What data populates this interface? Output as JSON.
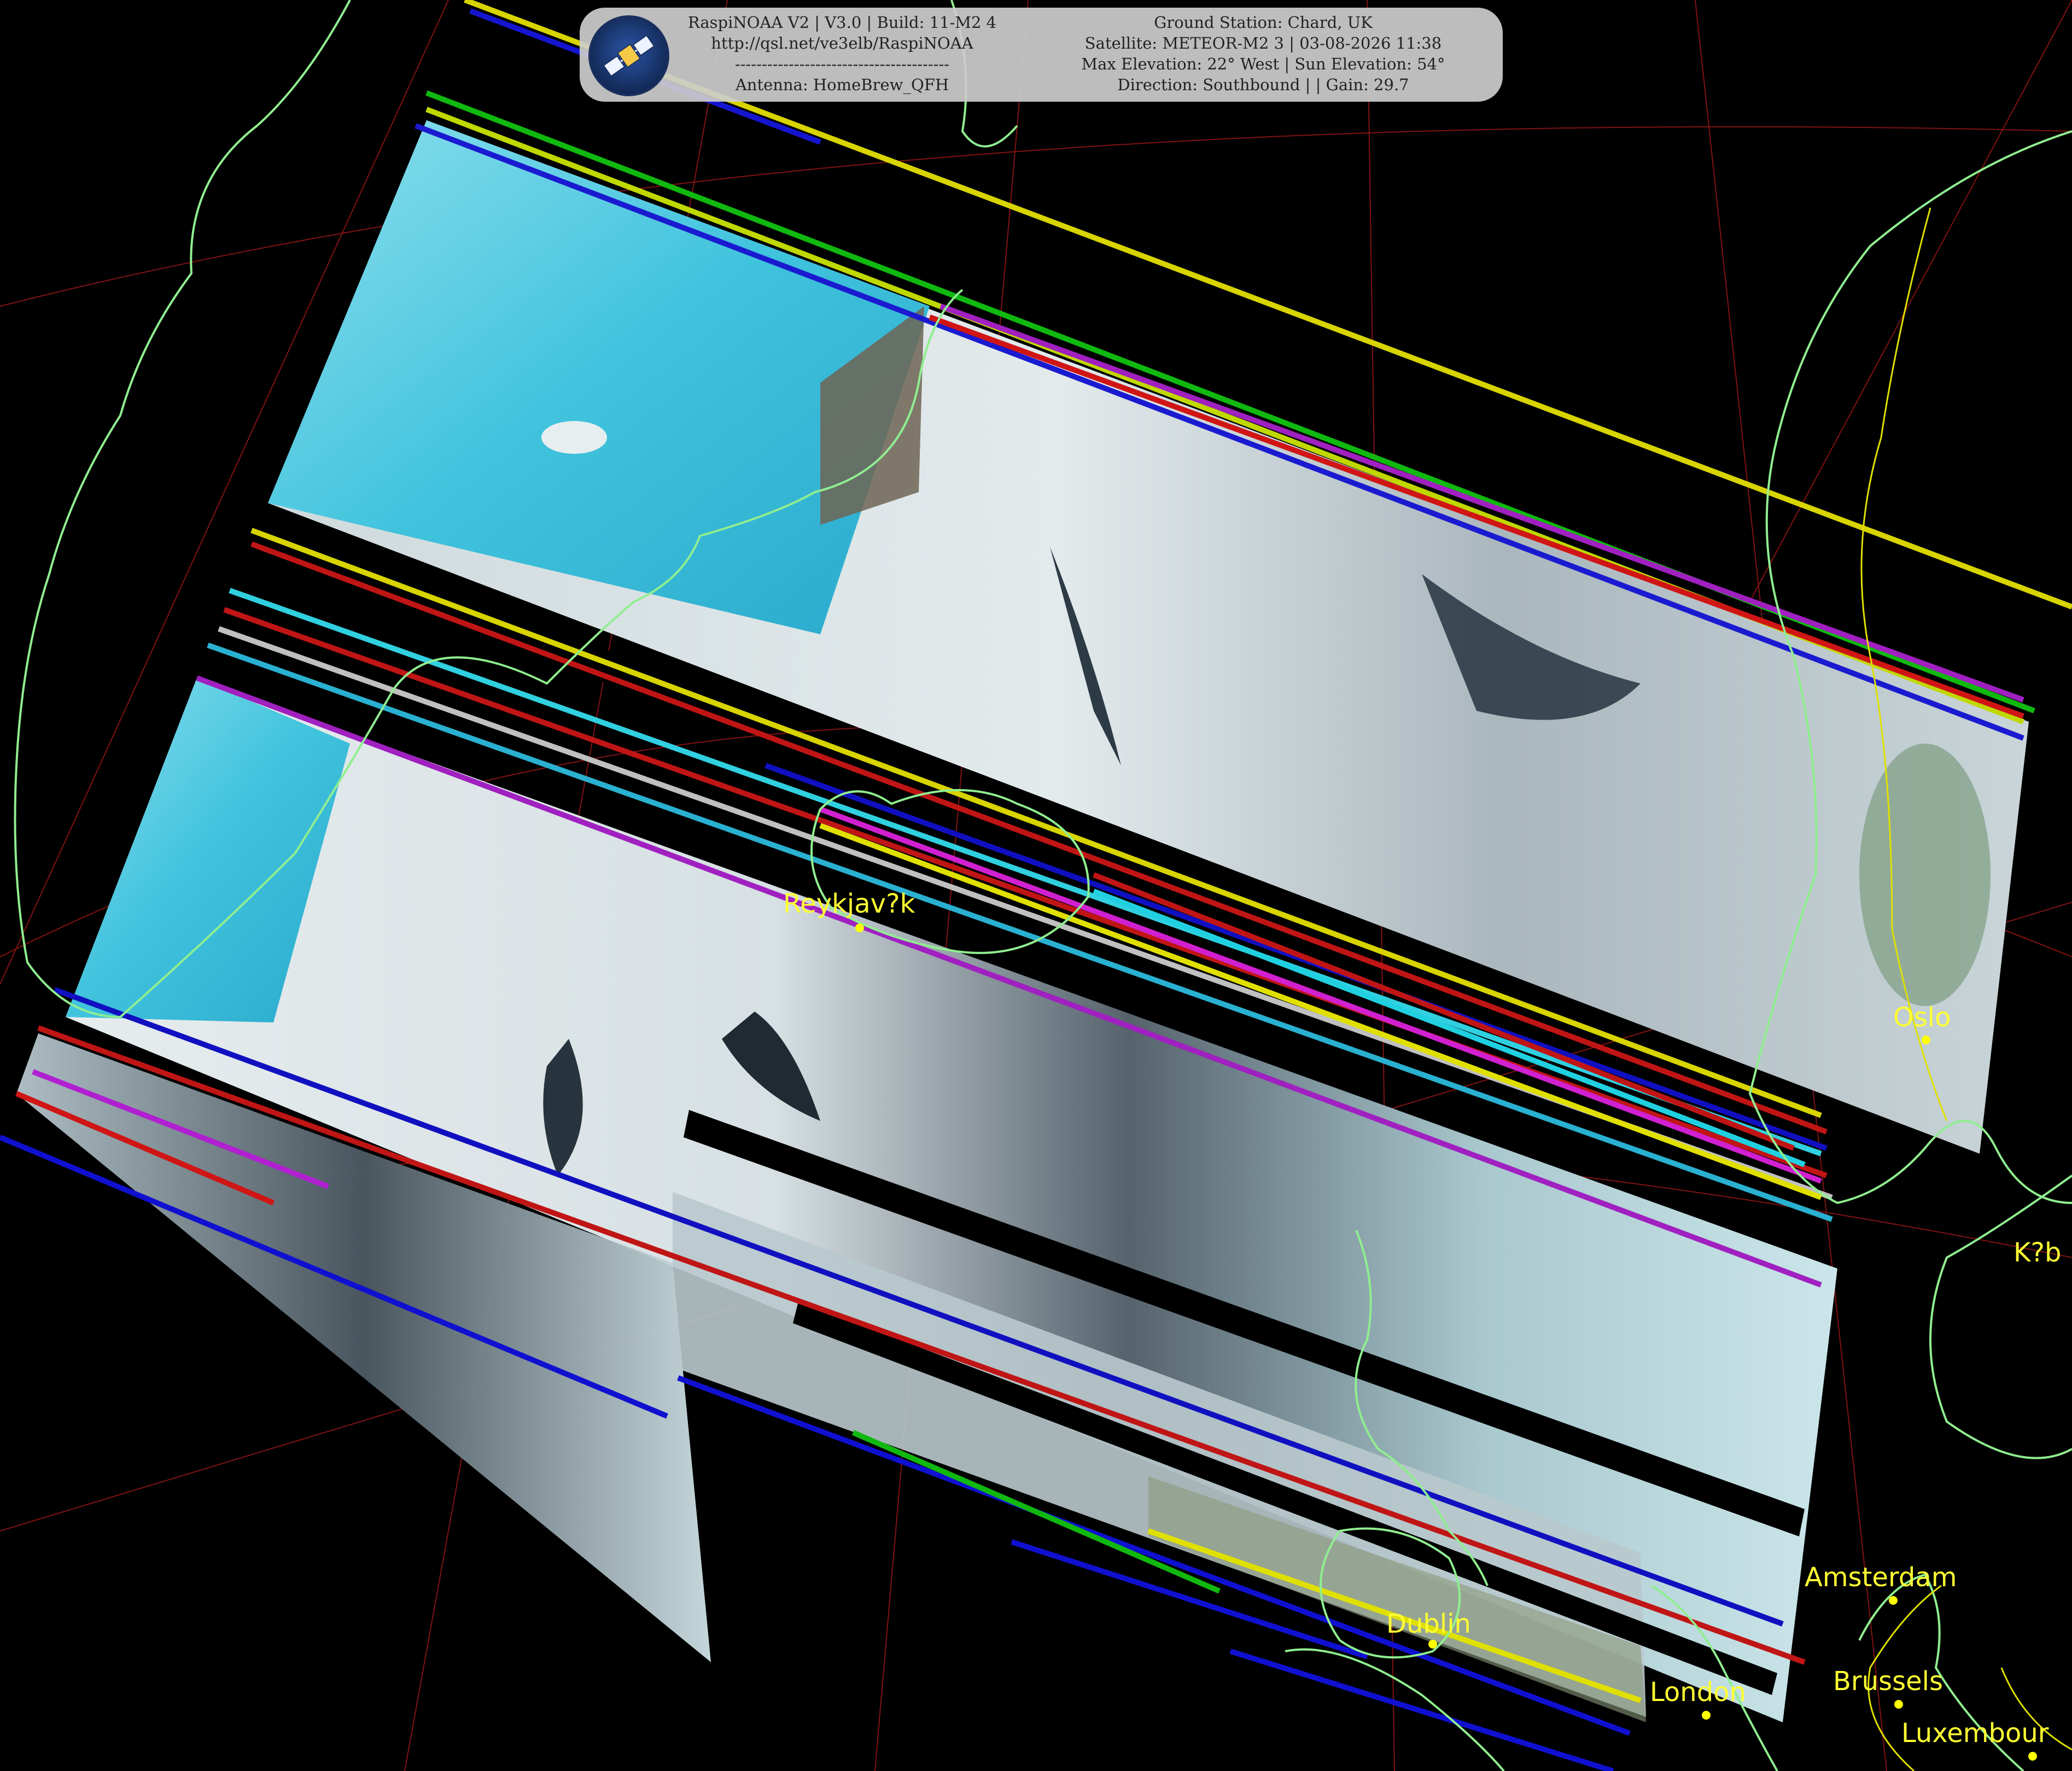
{
  "header": {
    "left_lines": [
      "RaspiNOAA V2 | V3.0 | Build: 11-M2 4",
      "http://qsl.net/ve3elb/RaspiNOAA",
      "----------------------------------------",
      "Antenna: HomeBrew_QFH"
    ],
    "right_lines": [
      "Ground Station: Chard, UK",
      "Satellite: METEOR-M2 3 | 03-08-2026 11:38",
      "Max Elevation: 22° West | Sun Elevation: 54°",
      "Direction: Southbound | | Gain: 29.7"
    ],
    "logo_icon": "satellite-icon"
  },
  "cities": [
    {
      "name": "Reykjav?k"
    },
    {
      "name": "Oslo"
    },
    {
      "name": "K?b"
    },
    {
      "name": "Amsterdam"
    },
    {
      "name": "Dublin"
    },
    {
      "name": "London"
    },
    {
      "name": "Brussels"
    },
    {
      "name": "Luxembour"
    }
  ],
  "colors": {
    "coastline": "#90ee90",
    "borders": "#e0e000",
    "graticule": "#c02020",
    "city_marker": "#ffff00",
    "ice": "#3fc0dc",
    "cloud": "#d8e4e6"
  }
}
